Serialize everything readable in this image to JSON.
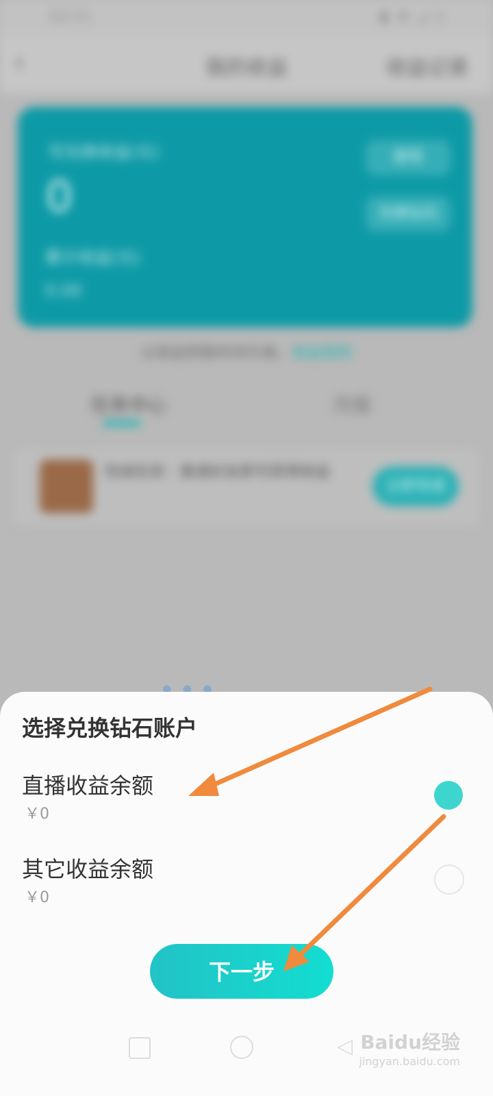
{
  "colors": {
    "accent": "#1fb4b3",
    "arrow": "#f08a3c",
    "card": "#0d9aa6"
  },
  "status_bar": {
    "time": "12:11",
    "indicators": "▮ ◔ ◿ ▯"
  },
  "header": {
    "back_icon": "chevron-left-icon",
    "title": "我的收益",
    "right_action": "收益记录"
  },
  "card": {
    "label": "可兑换收益(元)",
    "amount": "0",
    "sub_label": "累计收益(元)",
    "sub_value": "0.00",
    "btn_withdraw": "提现",
    "btn_exchange": "兑换钻石"
  },
  "notice": {
    "text": "以收益到账时间为准，",
    "link": "收益规则"
  },
  "tabs": [
    {
      "label": "任务中心"
    },
    {
      "label": "月报"
    }
  ],
  "task": {
    "text": "完成任务：邀请好友即可获得收益",
    "button": "立即完成"
  },
  "sheet": {
    "title": "选择兑换钻石账户",
    "options": [
      {
        "title": "直播收益余额",
        "value": "￥0",
        "selected": true
      },
      {
        "title": "其它收益余额",
        "value": "￥0",
        "selected": false
      }
    ],
    "next_button": "下一步"
  },
  "watermark": {
    "brand": "Baidu经验",
    "url": "jingyan.baidu.com"
  }
}
